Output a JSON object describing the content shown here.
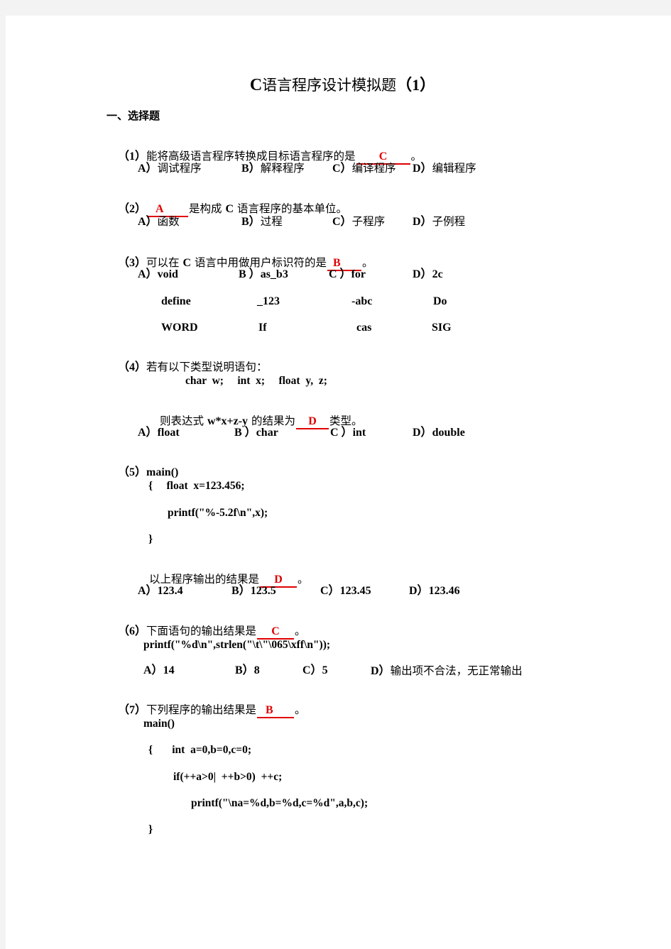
{
  "title": {
    "prefix": "C",
    "text": "语言程序设计模拟题",
    "num": "（1）"
  },
  "section": "一、选择题",
  "q1": {
    "num": "（1）",
    "text": "能将高级语言程序转换成目标语言程序的是",
    "answer": "C",
    "end": "。",
    "options": [
      {
        "key": "A）",
        "text": "调试程序"
      },
      {
        "key": "B）",
        "text": "解释程序"
      },
      {
        "key": "C）",
        "text": "编译程序"
      },
      {
        "key": "D）",
        "text": "编辑程序"
      }
    ]
  },
  "q2": {
    "num": "（2）",
    "answer": "A",
    "text_c": "是构成 ",
    "text_lang": "C",
    "text": " 语言程序的基本单位。",
    "options": [
      {
        "key": "A）",
        "text": "函数"
      },
      {
        "key": "B）",
        "text": "过程"
      },
      {
        "key": "C）",
        "text": "子程序"
      },
      {
        "key": "D）",
        "text": "子例程"
      }
    ]
  },
  "q3": {
    "num": "（3）",
    "text_pre": "可以在 ",
    "text_lang": "C",
    "text": " 语言中用做用户标识符的是",
    "answer": "B",
    "end": "。",
    "options": [
      {
        "key": "A）",
        "items": [
          "void",
          "define",
          "WORD"
        ]
      },
      {
        "key": "B ）",
        "items": [
          "as_b3",
          "_123",
          "If"
        ]
      },
      {
        "key": "C ）",
        "items": [
          "for",
          "-abc",
          "cas"
        ]
      },
      {
        "key": "D）",
        "items": [
          "2c",
          "Do",
          "SIG"
        ]
      }
    ]
  },
  "q4": {
    "num": "（4）",
    "text": "若有以下类型说明语句：",
    "code": "char  w;     int  x;     float  y,  z;",
    "expr_pre": "则表达式 ",
    "expr": "w*x+z-y",
    "expr_post": " 的结果为",
    "answer": "D",
    "end": "类型。",
    "options": [
      {
        "key": "A）",
        "text": "float"
      },
      {
        "key": "B ）",
        "text": "char"
      },
      {
        "key": "C ）",
        "text": "int"
      },
      {
        "key": "D）",
        "text": "double"
      }
    ]
  },
  "q5": {
    "num": "（5）",
    "code_head": "main()",
    "code": [
      "{     float  x=123.456;",
      "printf(\"%-5.2f\\n\",x);",
      "}"
    ],
    "text": "以上程序输出的结果是",
    "answer": "D",
    "end": "。",
    "options": [
      {
        "key": "A）",
        "text": "123.4"
      },
      {
        "key": "B）",
        "text": "123.5"
      },
      {
        "key": "C）",
        "text": "123.45"
      },
      {
        "key": "D）",
        "text": "123.46"
      }
    ]
  },
  "q6": {
    "num": "（6）",
    "text": "下面语句的输出结果是",
    "answer": "C",
    "end": "。",
    "code": "printf(\"%d\\n\",strlen(\"\\t\\\"\\065\\xff\\n\"));",
    "options": [
      {
        "key": "A）",
        "text": "14"
      },
      {
        "key": "B）",
        "text": "8"
      },
      {
        "key": "C）",
        "text": "5"
      },
      {
        "key": "D）",
        "text": "输出项不合法，无正常输出"
      }
    ]
  },
  "q7": {
    "num": "（7）",
    "text": "下列程序的输出结果是",
    "answer": "B",
    "end": "。",
    "code": [
      "main()",
      "{       int  a=0,b=0,c=0;",
      "if(++a>0|  ++b>0)  ++c;",
      "printf(\"\\na=%d,b=%d,c=%d\",a,b,c);",
      "}"
    ]
  }
}
